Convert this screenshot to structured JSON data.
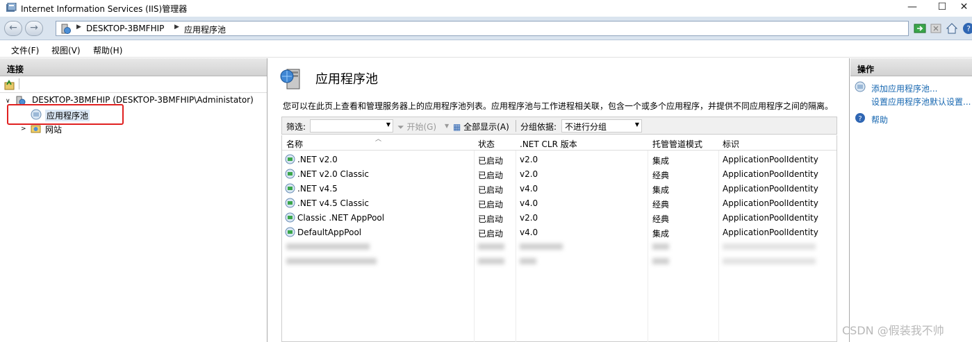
{
  "window": {
    "title": "Internet Information Services (IIS)管理器",
    "minimize": "—",
    "maximize": "☐",
    "close": "✕"
  },
  "address": {
    "crumbs": [
      "DESKTOP-3BMFHIP",
      "应用程序池"
    ]
  },
  "menu": [
    "文件(F)",
    "视图(V)",
    "帮助(H)"
  ],
  "connections": {
    "header": "连接",
    "server": "DESKTOP-3BMFHIP (DESKTOP-3BMFHIP\\Administator)",
    "app_pools": "应用程序池",
    "sites": "网站"
  },
  "main": {
    "title": "应用程序池",
    "description": "您可以在此页上查看和管理服务器上的应用程序池列表。应用程序池与工作进程相关联，包含一个或多个应用程序，并提供不同应用程序之间的隔离。",
    "filter_label": "筛选:",
    "start_label": "开始(G)",
    "show_all_label": "全部显示(A)",
    "group_label": "分组依据:",
    "group_value": "不进行分组",
    "columns": [
      "名称",
      "状态",
      ".NET CLR 版本",
      "托管管道模式",
      "标识"
    ],
    "rows": [
      {
        "name": ".NET v2.0",
        "status": "已启动",
        "clr": "v2.0",
        "mode": "集成",
        "identity": "ApplicationPoolIdentity"
      },
      {
        "name": ".NET v2.0 Classic",
        "status": "已启动",
        "clr": "v2.0",
        "mode": "经典",
        "identity": "ApplicationPoolIdentity"
      },
      {
        "name": ".NET v4.5",
        "status": "已启动",
        "clr": "v4.0",
        "mode": "集成",
        "identity": "ApplicationPoolIdentity"
      },
      {
        "name": ".NET v4.5 Classic",
        "status": "已启动",
        "clr": "v4.0",
        "mode": "经典",
        "identity": "ApplicationPoolIdentity"
      },
      {
        "name": "Classic .NET AppPool",
        "status": "已启动",
        "clr": "v2.0",
        "mode": "经典",
        "identity": "ApplicationPoolIdentity"
      },
      {
        "name": "DefaultAppPool",
        "status": "已启动",
        "clr": "v4.0",
        "mode": "集成",
        "identity": "ApplicationPoolIdentity"
      }
    ]
  },
  "actions": {
    "header": "操作",
    "add_pool": "添加应用程序池...",
    "set_defaults": "设置应用程序池默认设置...",
    "help": "帮助"
  },
  "watermark": "CSDN @假装我不帅"
}
